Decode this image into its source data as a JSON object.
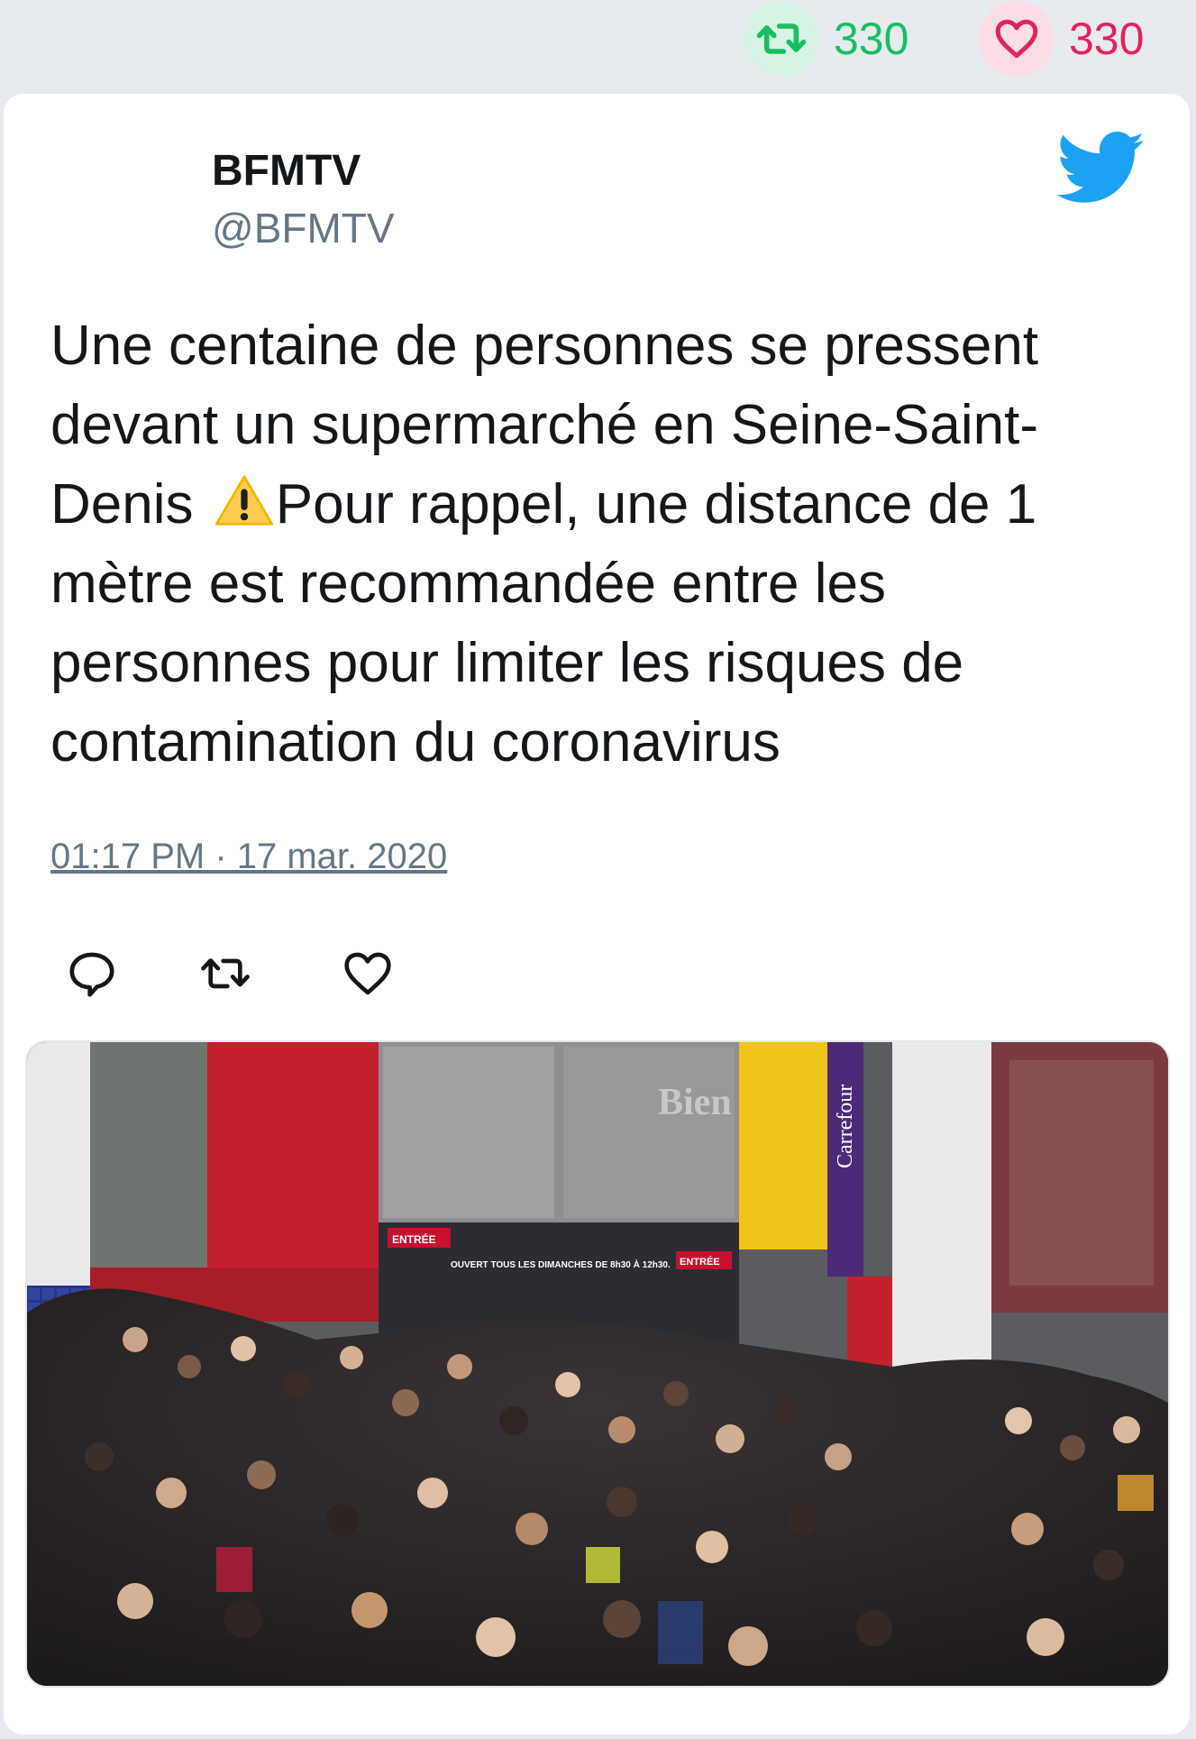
{
  "stats": {
    "retweets_icon": "retweet-icon",
    "retweets": "330",
    "likes_icon": "heart-icon",
    "likes": "330",
    "retweet_color": "#17bf63",
    "like_color": "#e0245e"
  },
  "tweet": {
    "author_name": "BFMTV",
    "author_handle": "@BFMTV",
    "text_part1": "Une centaine de personnes se pressent devant un supermarché en Seine-Saint-Denis ",
    "emoji": "warning-icon",
    "text_part2": "Pour rappel, une distance de 1 mètre est recommandée entre les personnes pour limiter les risques de contamination du coronavirus",
    "timestamp": "01:17 PM · 17 mar. 2020",
    "brand_color": "#1da1f2"
  },
  "actions": [
    {
      "name": "reply",
      "icon": "reply-icon"
    },
    {
      "name": "retweet",
      "icon": "retweet-icon"
    },
    {
      "name": "like",
      "icon": "heart-outline-icon"
    }
  ],
  "media": {
    "sign_entree_left": "ENTRÉE",
    "sign_hours": "OUVERT TOUS LES DIMANCHES DE 8h30 À 12h30.",
    "sign_entree_right": "ENTRÉE",
    "banner": "Carrefour",
    "facade_sign": "Bien"
  }
}
